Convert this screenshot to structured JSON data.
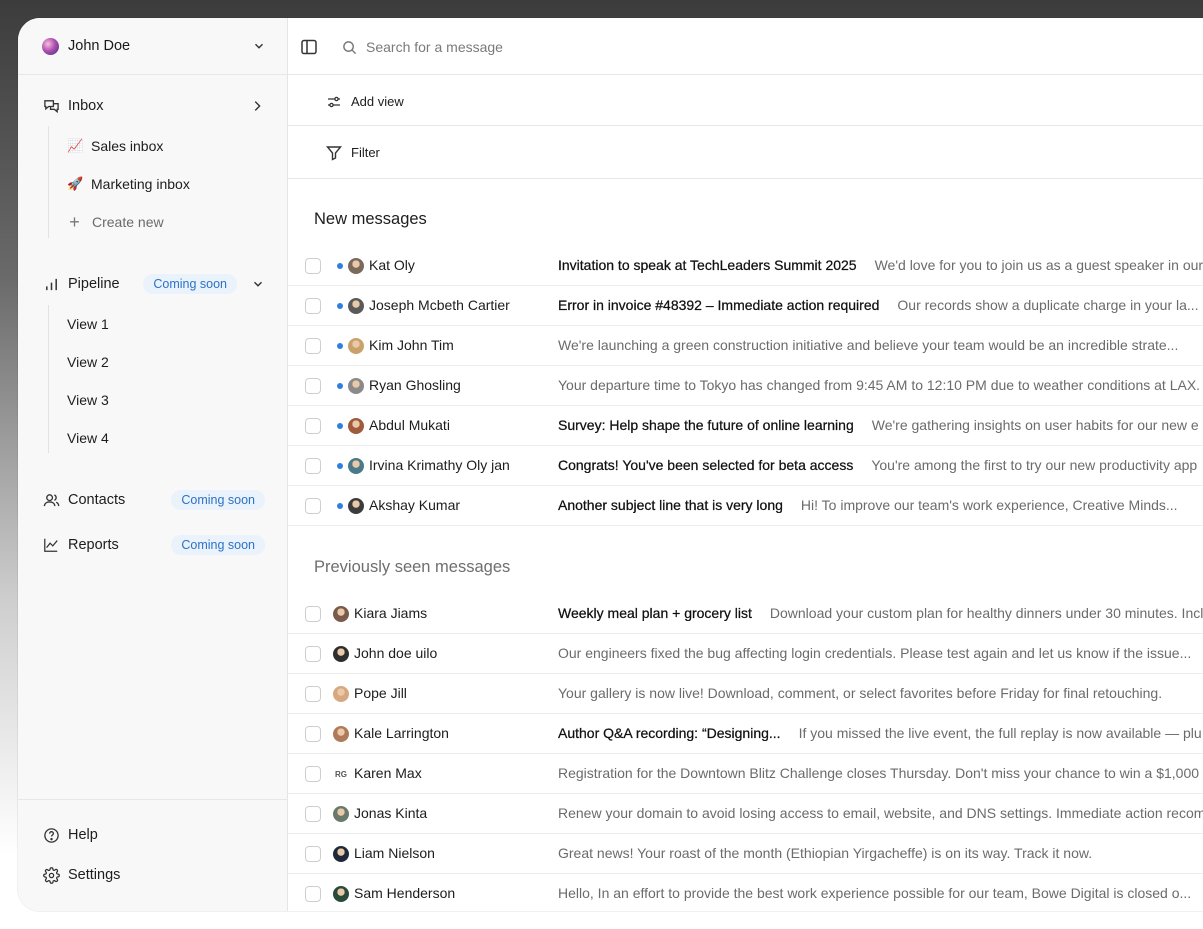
{
  "user": {
    "name": "John Doe"
  },
  "sidebar": {
    "inbox": {
      "label": "Inbox"
    },
    "inbox_items": [
      {
        "emoji": "📈",
        "label": "Sales inbox"
      },
      {
        "emoji": "🚀",
        "label": "Marketing inbox"
      }
    ],
    "create_new": "Create new",
    "pipeline": {
      "label": "Pipeline",
      "badge": "Coming soon"
    },
    "views": [
      "View 1",
      "View 2",
      "View 3",
      "View 4"
    ],
    "contacts": {
      "label": "Contacts",
      "badge": "Coming soon"
    },
    "reports": {
      "label": "Reports",
      "badge": "Coming soon"
    },
    "help": "Help",
    "settings": "Settings"
  },
  "search": {
    "placeholder": "Search for a message"
  },
  "toolbar": {
    "add_view": "Add view",
    "filter": "Filter"
  },
  "new_messages": {
    "title": "New messages",
    "rows": [
      {
        "sender": "Kat Oly",
        "subject": "Invitation to speak at TechLeaders Summit 2025",
        "preview": "We'd love for you to join us as a guest speaker in our",
        "avatar_color": "#7a6a5c"
      },
      {
        "sender": "Joseph Mcbeth Cartier",
        "subject": "Error in invoice #48392 – Immediate action required",
        "preview": "Our records show a duplicate charge in your la...",
        "avatar_color": "#5a5a5a",
        "tag_color": "#e4e9f3"
      },
      {
        "sender": "Kim John Tim",
        "subject": "",
        "preview": "We're launching a green construction initiative and believe your team would be an incredible strate...",
        "avatar_color": "#c9a26b",
        "tag_color": "#fbeed6"
      },
      {
        "sender": "Ryan Ghosling",
        "subject": "",
        "preview": "Your departure time to Tokyo has changed from 9:45 AM to 12:10 PM due to weather conditions at LAX.",
        "avatar_color": "#8a8a8a"
      },
      {
        "sender": "Abdul Mukati",
        "subject": "Survey: Help shape the future of online learning",
        "preview": "We're gathering insights on user habits for our new e",
        "avatar_color": "#a05a3c"
      },
      {
        "sender": "Irvina Krimathy Oly jan",
        "subject": "Congrats! You've been selected for beta access",
        "preview": "You're among the first to try our new productivity app",
        "avatar_color": "#4a7a8a"
      },
      {
        "sender": "Akshay Kumar",
        "subject": "Another subject line that is very long",
        "preview": "Hi! To improve our team's work experience, Creative Minds...",
        "avatar_color": "#3c3c3c",
        "tag_color": "#f3f0dc"
      }
    ]
  },
  "seen_messages": {
    "title": "Previously seen messages",
    "rows": [
      {
        "sender": "Kiara Jiams",
        "subject": "Weekly meal plan + grocery list",
        "preview": "Download your custom plan for healthy dinners under 30 minutes. Incl",
        "avatar_color": "#7a5a4c"
      },
      {
        "sender": "John doe uilo",
        "subject": "",
        "preview": "Our engineers fixed the bug affecting login credentials. Please test again and let us know if the issue...",
        "avatar_color": "#2e2e2e",
        "tag_color": "#ece6f6"
      },
      {
        "sender": "Pope Jill",
        "subject": "",
        "preview": "Your gallery is now live! Download, comment, or select favorites before Friday for final retouching.",
        "avatar_color": "#d7a880"
      },
      {
        "sender": "Kale Larrington",
        "subject": "Author Q&A recording: “Designing...",
        "preview": "If you missed the live event, the full replay is now available — plu",
        "avatar_color": "#b07a5a"
      },
      {
        "sender": "Karen Max",
        "initials": "RG",
        "subject": "",
        "preview": "Registration for the Downtown Blitz Challenge closes Thursday. Don't miss your chance to win a $1,000 p",
        "avatar_color": ""
      },
      {
        "sender": "Jonas Kinta",
        "subject": "",
        "preview": "Renew your domain to avoid losing access to email, website, and DNS settings. Immediate action recomm",
        "avatar_color": "#6a7a6a"
      },
      {
        "sender": "Liam Nielson",
        "subject": "",
        "preview": "Great news! Your roast of the month (Ethiopian Yirgacheffe) is on its way. Track it now.",
        "avatar_color": "#1e2a3a"
      },
      {
        "sender": "Sam Henderson",
        "subject": "",
        "preview": "Hello, In an effort to provide the best work experience possible for our team, Bowe Digital is closed o...",
        "avatar_color": "#2a4a3a",
        "tag_color": "#f6ecd6"
      }
    ]
  }
}
